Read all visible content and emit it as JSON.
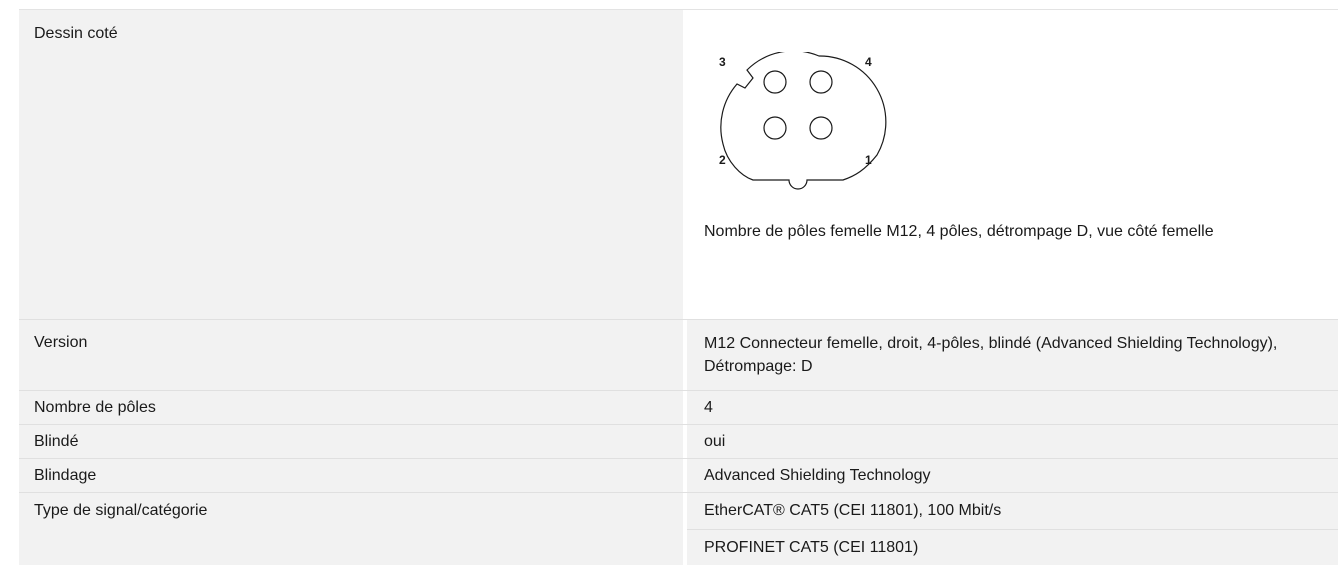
{
  "rows": {
    "drawing": {
      "label": "Dessin coté",
      "pins": [
        "3",
        "4",
        "2",
        "1"
      ],
      "caption": "Nombre de pôles femelle M12, 4 pôles, détrompage D, vue côté femelle"
    },
    "version": {
      "label": "Version",
      "value": "M12 Connecteur femelle, droit, 4-pôles, blindé (Advanced Shielding Technology), Détrompage: D"
    },
    "poles": {
      "label": "Nombre de pôles",
      "value": "4"
    },
    "shielded": {
      "label": "Blindé",
      "value": "oui"
    },
    "shielding": {
      "label": "Blindage",
      "value": "Advanced Shielding Technology"
    },
    "signal": {
      "label": "Type de signal/catégorie",
      "values": [
        "EtherCAT® CAT5 (CEI 11801), 100 Mbit/s",
        "PROFINET CAT5 (CEI 11801)"
      ]
    }
  }
}
